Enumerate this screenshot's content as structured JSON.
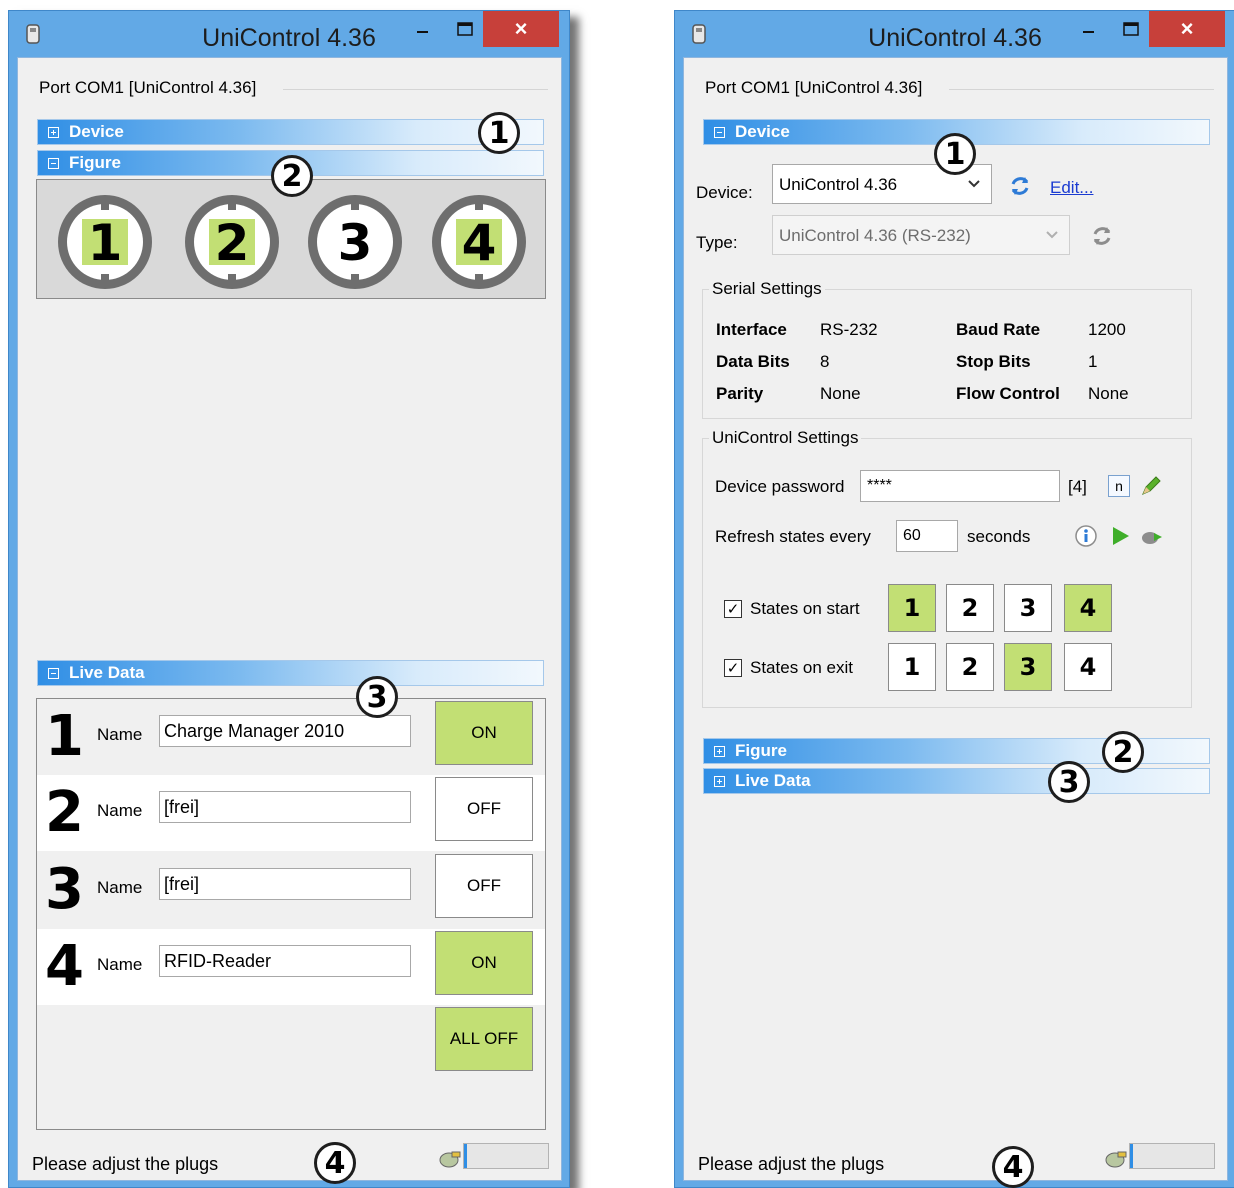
{
  "left_window": {
    "title": "UniControl 4.36",
    "close_glyph": "×",
    "port_label": "Port COM1  [UniControl 4.36]",
    "sections": {
      "device": "Device",
      "figure": "Figure",
      "live_data": "Live Data"
    },
    "figure_plugs": [
      {
        "label": "1",
        "state": "on"
      },
      {
        "label": "2",
        "state": "on"
      },
      {
        "label": "3",
        "state": "off"
      },
      {
        "label": "4",
        "state": "on"
      }
    ],
    "live_rows": [
      {
        "num": "1",
        "name_label": "Name",
        "value": "Charge Manager 2010",
        "state_label": "ON",
        "state": "on"
      },
      {
        "num": "2",
        "name_label": "Name",
        "value": "[frei]",
        "state_label": "OFF",
        "state": "off"
      },
      {
        "num": "3",
        "name_label": "Name",
        "value": "[frei]",
        "state_label": "OFF",
        "state": "off"
      },
      {
        "num": "4",
        "name_label": "Name",
        "value": "RFID-Reader",
        "state_label": "ON",
        "state": "on"
      }
    ],
    "all_off_label": "ALL OFF",
    "status_text": "Please adjust the plugs",
    "callouts": [
      "1",
      "2",
      "3",
      "4"
    ]
  },
  "right_window": {
    "title": "UniControl 4.36",
    "close_glyph": "×",
    "port_label": "Port COM1  [UniControl 4.36]",
    "sections": {
      "device": "Device",
      "figure": "Figure",
      "live_data": "Live Data"
    },
    "device_label": "Device:",
    "device_value": "UniControl 4.36",
    "edit_link": "Edit...",
    "type_label": "Type:",
    "type_value": "UniControl 4.36 (RS-232)",
    "serial_settings": {
      "title": "Serial Settings",
      "interface_key": "Interface",
      "interface_val": "RS-232",
      "baud_key": "Baud Rate",
      "baud_val": "1200",
      "databits_key": "Data Bits",
      "databits_val": "8",
      "stopbits_key": "Stop Bits",
      "stopbits_val": "1",
      "parity_key": "Parity",
      "parity_val": "None",
      "flow_key": "Flow Control",
      "flow_val": "None"
    },
    "unicontrol_settings": {
      "title": "UniControl Settings",
      "password_label": "Device password",
      "password_value": "****",
      "password_len": "[4]",
      "n_button": "n",
      "refresh_label": "Refresh states every",
      "refresh_value": "60",
      "seconds_label": "seconds",
      "states_on_start_label": "States on start",
      "states_on_exit_label": "States on exit",
      "check_glyph": "✓",
      "start_states": [
        {
          "label": "1",
          "state": "on"
        },
        {
          "label": "2",
          "state": "off"
        },
        {
          "label": "3",
          "state": "off"
        },
        {
          "label": "4",
          "state": "on"
        }
      ],
      "exit_states": [
        {
          "label": "1",
          "state": "off"
        },
        {
          "label": "2",
          "state": "off"
        },
        {
          "label": "3",
          "state": "on"
        },
        {
          "label": "4",
          "state": "off"
        }
      ]
    },
    "status_text": "Please adjust the plugs",
    "callouts": [
      "1",
      "2",
      "3",
      "4"
    ]
  },
  "colors": {
    "frame": "#62a9e6",
    "close": "#c7403a",
    "section_start": "#2f8ee5",
    "on_state": "#c2df74",
    "link": "#1a3bd1"
  },
  "icons": [
    "app-icon",
    "minimize-icon",
    "maximize-icon",
    "close-icon",
    "expand-icon",
    "collapse-icon",
    "refresh-icon",
    "edit-pencil-icon",
    "info-icon",
    "play-icon",
    "plug-status-icon",
    "chevron-down-icon"
  ]
}
